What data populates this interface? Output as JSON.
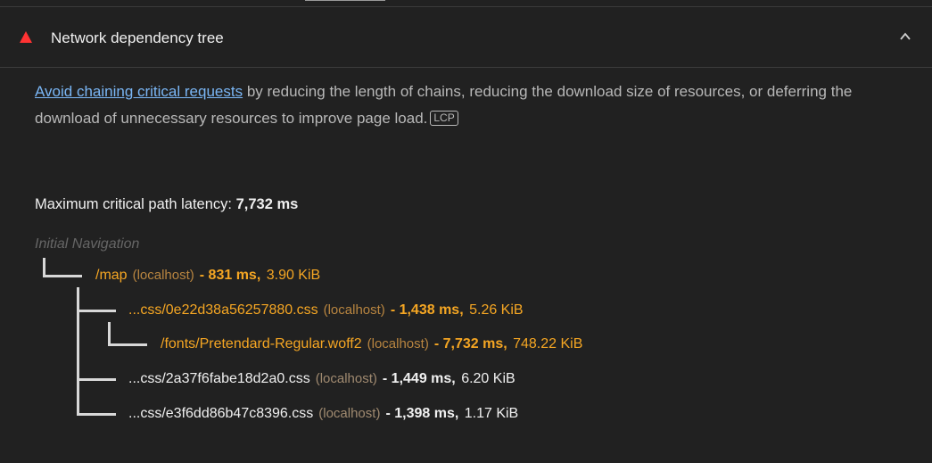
{
  "audit": {
    "title": "Network dependency tree",
    "status_color": "#ff3333"
  },
  "description": {
    "link_text": "Avoid chaining critical requests",
    "text": "by reducing the length of chains, reducing the download size of resources, or deferring the download of unnecessary resources to improve page load.",
    "badge": "LCP"
  },
  "latency": {
    "label": "Maximum critical path latency:",
    "value": "7,732 ms"
  },
  "tree": {
    "root_label": "Initial Navigation",
    "nodes": [
      {
        "url": "/map",
        "host": "(localhost)",
        "time": "- 831 ms,",
        "size": "3.90 KiB",
        "highlight": true
      },
      {
        "url": "...css/0e22d38a56257880.css",
        "host": "(localhost)",
        "time": "- 1,438 ms,",
        "size": "5.26 KiB",
        "highlight": true
      },
      {
        "url": "/fonts/Pretendard-Regular.woff2",
        "host": "(localhost)",
        "time": "- 7,732 ms,",
        "size": "748.22 KiB",
        "highlight": true
      },
      {
        "url": "...css/2a37f6fabe18d2a0.css",
        "host": "(localhost)",
        "time": "- 1,449 ms,",
        "size": "6.20 KiB",
        "highlight": false
      },
      {
        "url": "...css/e3f6dd86b47c8396.css",
        "host": "(localhost)",
        "time": "- 1,398 ms,",
        "size": "1.17 KiB",
        "highlight": false
      }
    ]
  },
  "colors": {
    "background": "#212121",
    "highlight": "#f5a623",
    "link": "#7ab6f5"
  }
}
